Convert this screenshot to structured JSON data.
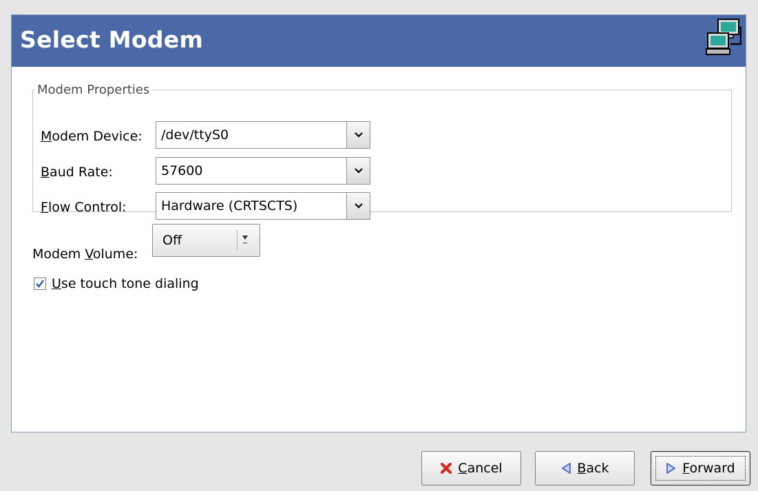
{
  "header": {
    "title": "Select Modem",
    "icon": "network-computers-icon"
  },
  "modem_properties": {
    "legend": "Modem Properties",
    "device": {
      "label_accel": "M",
      "label_rest": "odem Device:",
      "value": "/dev/ttyS0"
    },
    "baud": {
      "label_accel": "B",
      "label_rest": "aud Rate:",
      "value": "57600"
    },
    "flow": {
      "label_accel": "F",
      "label_rest": "low Control:",
      "value": "Hardware (CRTSCTS)"
    }
  },
  "volume": {
    "label_pre": "Modem ",
    "label_accel": "V",
    "label_rest": "olume:",
    "value": "Off"
  },
  "touch_tone": {
    "checked": true,
    "label_accel": "U",
    "label_rest": "se touch tone dialing"
  },
  "buttons": {
    "cancel": {
      "accel": "C",
      "rest": "ancel",
      "icon": "cancel-x-icon"
    },
    "back": {
      "accel": "B",
      "rest": "ack",
      "icon": "back-arrow-icon"
    },
    "forward": {
      "accel": "F",
      "rest": "orward",
      "icon": "forward-arrow-icon"
    }
  },
  "colors": {
    "banner": "#4b69a6",
    "cancel_icon": "#d4281e",
    "arrow_icon": "#5a6fc0",
    "checkmark": "#3a5fb0"
  }
}
